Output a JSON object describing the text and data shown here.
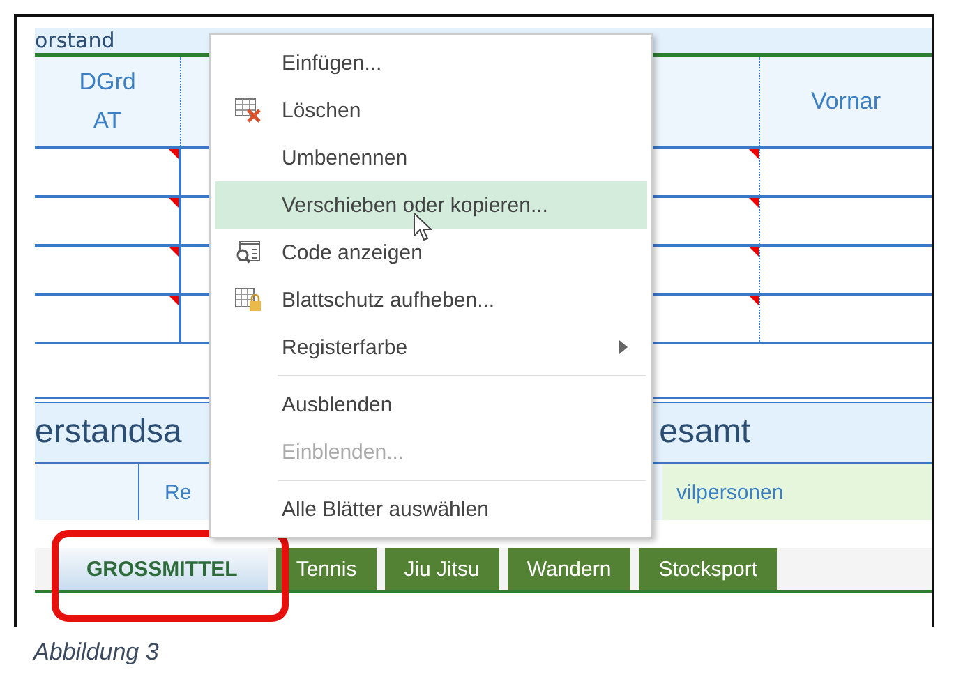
{
  "sheet": {
    "banner": "orstand",
    "columns": [
      {
        "label": "DGrd\nAT"
      },
      {
        "label": "Vornar"
      }
    ],
    "rows": [
      {
        "commented": true
      },
      {
        "commented": true
      },
      {
        "commented": true
      },
      {
        "commented": true
      }
    ],
    "section_title": {
      "left": "erstandsa",
      "right": "esamt"
    },
    "subheader": {
      "left": "Re",
      "right": "vilpersonen"
    }
  },
  "context_menu": {
    "items": [
      {
        "kind": "item",
        "label": "Einfügen...",
        "selected": false,
        "disabled": false
      },
      {
        "kind": "item",
        "label": "Löschen",
        "selected": false,
        "disabled": false
      },
      {
        "kind": "item",
        "label": "Umbenennen",
        "selected": false,
        "disabled": false
      },
      {
        "kind": "item",
        "label": "Verschieben oder kopieren...",
        "selected": true,
        "disabled": false
      },
      {
        "kind": "item",
        "label": "Code anzeigen",
        "selected": false,
        "disabled": false
      },
      {
        "kind": "item",
        "label": "Blattschutz aufheben...",
        "selected": false,
        "disabled": false
      },
      {
        "kind": "submenu",
        "label": "Registerfarbe",
        "selected": false,
        "disabled": false
      },
      {
        "kind": "separator"
      },
      {
        "kind": "item",
        "label": "Ausblenden",
        "selected": false,
        "disabled": false
      },
      {
        "kind": "item",
        "label": "Einblenden...",
        "selected": false,
        "disabled": true
      },
      {
        "kind": "separator"
      },
      {
        "kind": "item",
        "label": "Alle Blätter auswählen",
        "selected": false,
        "disabled": false
      }
    ]
  },
  "sheet_tabs": [
    {
      "label": "GROSSMITTEL",
      "selected": true
    },
    {
      "label": "Tennis",
      "selected": false
    },
    {
      "label": "Jiu Jitsu",
      "selected": false
    },
    {
      "label": "Wandern",
      "selected": false
    },
    {
      "label": "Stocksport",
      "selected": false
    }
  ],
  "caption": "Abbildung 3"
}
